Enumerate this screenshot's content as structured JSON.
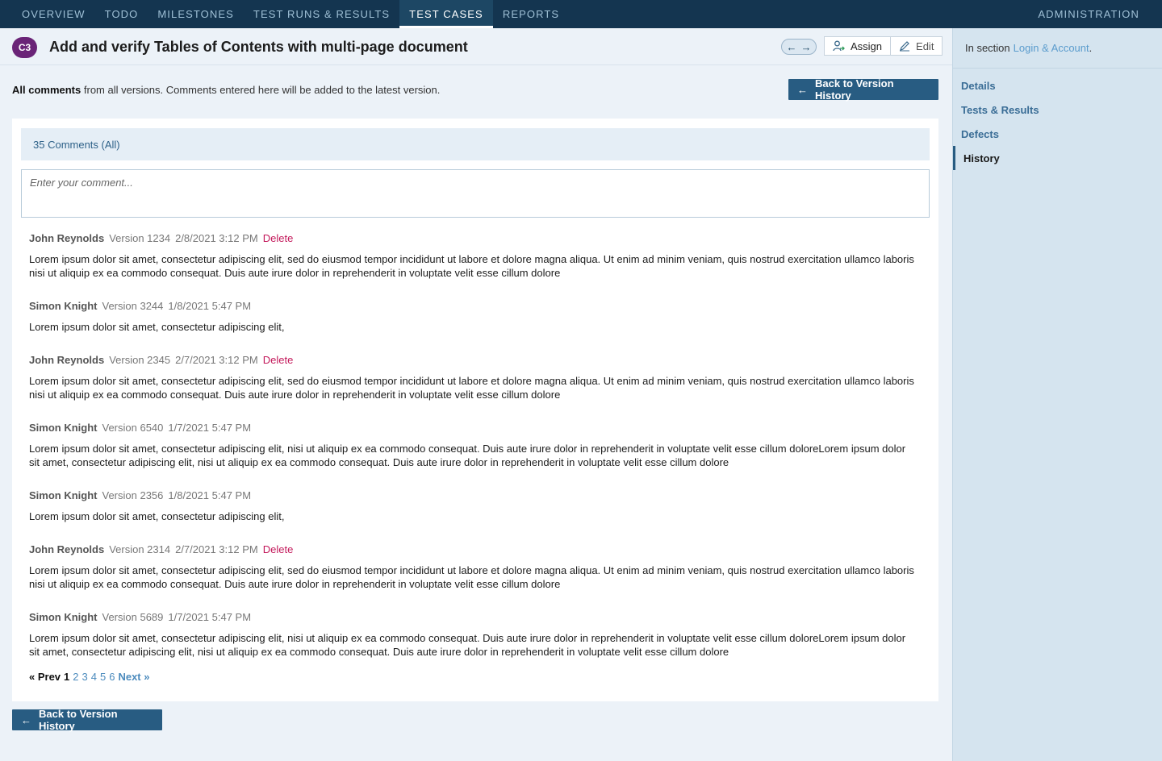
{
  "topnav": {
    "tabs": [
      {
        "label": "OVERVIEW"
      },
      {
        "label": "TODO"
      },
      {
        "label": "MILESTONES"
      },
      {
        "label": "TEST RUNS & RESULTS"
      },
      {
        "label": "TEST CASES"
      },
      {
        "label": "REPORTS"
      }
    ],
    "active_tab": "TEST CASES",
    "admin_label": "ADMINISTRATION"
  },
  "header": {
    "badge": "C3",
    "title": "Add and verify Tables of Contents with multi-page document",
    "assign_label": "Assign",
    "edit_label": "Edit",
    "prev_arrow": "←",
    "next_arrow": "→"
  },
  "info": {
    "bold": "All comments",
    "rest": "from  all versions. Comments entered here will be added to the latest version."
  },
  "back_button_label": "Back to Version History",
  "comments_panel": {
    "count_label": "35 Comments (All)",
    "input_placeholder": "Enter your comment...",
    "delete_label": "Delete",
    "items": [
      {
        "author": "John Reynolds",
        "version": "Version 1234",
        "date": "2/8/2021 3:12 PM",
        "deletable": true,
        "text": "Lorem ipsum dolor sit amet, consectetur adipiscing elit, sed do eiusmod tempor incididunt ut labore et dolore magna aliqua. Ut enim ad minim veniam, quis nostrud exercitation ullamco laboris nisi ut aliquip ex ea commodo consequat. Duis aute irure dolor in reprehenderit in voluptate velit esse cillum dolore"
      },
      {
        "author": "Simon Knight",
        "version": "Version 3244",
        "date": "1/8/2021 5:47 PM",
        "deletable": false,
        "text": "Lorem ipsum dolor sit amet, consectetur adipiscing elit,"
      },
      {
        "author": "John Reynolds",
        "version": "Version 2345",
        "date": "2/7/2021 3:12 PM",
        "deletable": true,
        "text": "Lorem ipsum dolor sit amet, consectetur adipiscing elit, sed do eiusmod tempor incididunt ut labore et dolore magna aliqua. Ut enim ad minim veniam, quis nostrud exercitation ullamco laboris nisi ut aliquip ex ea commodo consequat. Duis aute irure dolor in reprehenderit in voluptate velit esse cillum dolore"
      },
      {
        "author": "Simon Knight",
        "version": "Version 6540",
        "date": "1/7/2021 5:47 PM",
        "deletable": false,
        "text": "Lorem ipsum dolor sit amet, consectetur adipiscing elit, nisi ut aliquip ex ea commodo consequat. Duis aute irure dolor in reprehenderit in voluptate velit esse cillum doloreLorem ipsum dolor sit amet, consectetur adipiscing elit, nisi ut aliquip ex ea commodo consequat. Duis aute irure dolor in reprehenderit in voluptate velit esse cillum dolore"
      },
      {
        "author": "Simon Knight",
        "version": "Version 2356",
        "date": "1/8/2021 5:47 PM",
        "deletable": false,
        "text": "Lorem ipsum dolor sit amet, consectetur adipiscing elit,"
      },
      {
        "author": "John Reynolds",
        "version": "Version 2314",
        "date": "2/7/2021 3:12 PM",
        "deletable": true,
        "text": "Lorem ipsum dolor sit amet, consectetur adipiscing elit, sed do eiusmod tempor incididunt ut labore et dolore magna aliqua. Ut enim ad minim veniam, quis nostrud exercitation ullamco laboris nisi ut aliquip ex ea commodo consequat. Duis aute irure dolor in reprehenderit in voluptate velit esse cillum dolore"
      },
      {
        "author": "Simon Knight",
        "version": "Version 5689",
        "date": "1/7/2021 5:47 PM",
        "deletable": false,
        "text": "Lorem ipsum dolor sit amet, consectetur adipiscing elit, nisi ut aliquip ex ea commodo consequat. Duis aute irure dolor in reprehenderit in voluptate velit esse cillum doloreLorem ipsum dolor sit amet, consectetur adipiscing elit, nisi ut aliquip ex ea commodo consequat. Duis aute irure dolor in reprehenderit in voluptate velit esse cillum dolore"
      }
    ]
  },
  "pager": {
    "prev": "« Prev",
    "current": "1",
    "pages": [
      "2",
      "3",
      "4",
      "5",
      "6"
    ],
    "next": "Next »"
  },
  "sidebar": {
    "section_prefix": "In section",
    "section_link": "Login & Account",
    "section_suffix": ".",
    "items": [
      {
        "label": "Details"
      },
      {
        "label": "Tests & Results"
      },
      {
        "label": "Defects"
      },
      {
        "label": "History"
      }
    ],
    "active_item": "History"
  },
  "colors": {
    "nav_bg": "#143550",
    "primary": "#285c82",
    "badge": "#6a2477",
    "delete": "#c3185a",
    "link": "#4c8bbd"
  }
}
